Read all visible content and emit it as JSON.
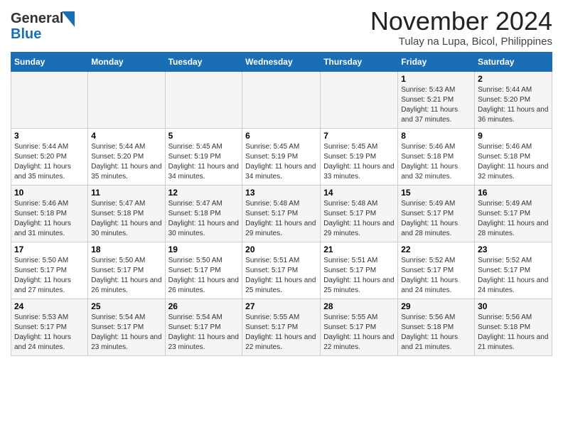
{
  "header": {
    "logo": {
      "line1": "General",
      "line2": "Blue"
    },
    "title": "November 2024",
    "location": "Tulay na Lupa, Bicol, Philippines"
  },
  "calendar": {
    "days_of_week": [
      "Sunday",
      "Monday",
      "Tuesday",
      "Wednesday",
      "Thursday",
      "Friday",
      "Saturday"
    ],
    "weeks": [
      [
        {
          "day": "",
          "info": ""
        },
        {
          "day": "",
          "info": ""
        },
        {
          "day": "",
          "info": ""
        },
        {
          "day": "",
          "info": ""
        },
        {
          "day": "",
          "info": ""
        },
        {
          "day": "1",
          "info": "Sunrise: 5:43 AM\nSunset: 5:21 PM\nDaylight: 11 hours\nand 37 minutes."
        },
        {
          "day": "2",
          "info": "Sunrise: 5:44 AM\nSunset: 5:20 PM\nDaylight: 11 hours\nand 36 minutes."
        }
      ],
      [
        {
          "day": "3",
          "info": "Sunrise: 5:44 AM\nSunset: 5:20 PM\nDaylight: 11 hours\nand 35 minutes."
        },
        {
          "day": "4",
          "info": "Sunrise: 5:44 AM\nSunset: 5:20 PM\nDaylight: 11 hours\nand 35 minutes."
        },
        {
          "day": "5",
          "info": "Sunrise: 5:45 AM\nSunset: 5:19 PM\nDaylight: 11 hours\nand 34 minutes."
        },
        {
          "day": "6",
          "info": "Sunrise: 5:45 AM\nSunset: 5:19 PM\nDaylight: 11 hours\nand 34 minutes."
        },
        {
          "day": "7",
          "info": "Sunrise: 5:45 AM\nSunset: 5:19 PM\nDaylight: 11 hours\nand 33 minutes."
        },
        {
          "day": "8",
          "info": "Sunrise: 5:46 AM\nSunset: 5:18 PM\nDaylight: 11 hours\nand 32 minutes."
        },
        {
          "day": "9",
          "info": "Sunrise: 5:46 AM\nSunset: 5:18 PM\nDaylight: 11 hours\nand 32 minutes."
        }
      ],
      [
        {
          "day": "10",
          "info": "Sunrise: 5:46 AM\nSunset: 5:18 PM\nDaylight: 11 hours\nand 31 minutes."
        },
        {
          "day": "11",
          "info": "Sunrise: 5:47 AM\nSunset: 5:18 PM\nDaylight: 11 hours\nand 30 minutes."
        },
        {
          "day": "12",
          "info": "Sunrise: 5:47 AM\nSunset: 5:18 PM\nDaylight: 11 hours\nand 30 minutes."
        },
        {
          "day": "13",
          "info": "Sunrise: 5:48 AM\nSunset: 5:17 PM\nDaylight: 11 hours\nand 29 minutes."
        },
        {
          "day": "14",
          "info": "Sunrise: 5:48 AM\nSunset: 5:17 PM\nDaylight: 11 hours\nand 29 minutes."
        },
        {
          "day": "15",
          "info": "Sunrise: 5:49 AM\nSunset: 5:17 PM\nDaylight: 11 hours\nand 28 minutes."
        },
        {
          "day": "16",
          "info": "Sunrise: 5:49 AM\nSunset: 5:17 PM\nDaylight: 11 hours\nand 28 minutes."
        }
      ],
      [
        {
          "day": "17",
          "info": "Sunrise: 5:50 AM\nSunset: 5:17 PM\nDaylight: 11 hours\nand 27 minutes."
        },
        {
          "day": "18",
          "info": "Sunrise: 5:50 AM\nSunset: 5:17 PM\nDaylight: 11 hours\nand 26 minutes."
        },
        {
          "day": "19",
          "info": "Sunrise: 5:50 AM\nSunset: 5:17 PM\nDaylight: 11 hours\nand 26 minutes."
        },
        {
          "day": "20",
          "info": "Sunrise: 5:51 AM\nSunset: 5:17 PM\nDaylight: 11 hours\nand 25 minutes."
        },
        {
          "day": "21",
          "info": "Sunrise: 5:51 AM\nSunset: 5:17 PM\nDaylight: 11 hours\nand 25 minutes."
        },
        {
          "day": "22",
          "info": "Sunrise: 5:52 AM\nSunset: 5:17 PM\nDaylight: 11 hours\nand 24 minutes."
        },
        {
          "day": "23",
          "info": "Sunrise: 5:52 AM\nSunset: 5:17 PM\nDaylight: 11 hours\nand 24 minutes."
        }
      ],
      [
        {
          "day": "24",
          "info": "Sunrise: 5:53 AM\nSunset: 5:17 PM\nDaylight: 11 hours\nand 24 minutes."
        },
        {
          "day": "25",
          "info": "Sunrise: 5:54 AM\nSunset: 5:17 PM\nDaylight: 11 hours\nand 23 minutes."
        },
        {
          "day": "26",
          "info": "Sunrise: 5:54 AM\nSunset: 5:17 PM\nDaylight: 11 hours\nand 23 minutes."
        },
        {
          "day": "27",
          "info": "Sunrise: 5:55 AM\nSunset: 5:17 PM\nDaylight: 11 hours\nand 22 minutes."
        },
        {
          "day": "28",
          "info": "Sunrise: 5:55 AM\nSunset: 5:17 PM\nDaylight: 11 hours\nand 22 minutes."
        },
        {
          "day": "29",
          "info": "Sunrise: 5:56 AM\nSunset: 5:18 PM\nDaylight: 11 hours\nand 21 minutes."
        },
        {
          "day": "30",
          "info": "Sunrise: 5:56 AM\nSunset: 5:18 PM\nDaylight: 11 hours\nand 21 minutes."
        }
      ]
    ]
  }
}
